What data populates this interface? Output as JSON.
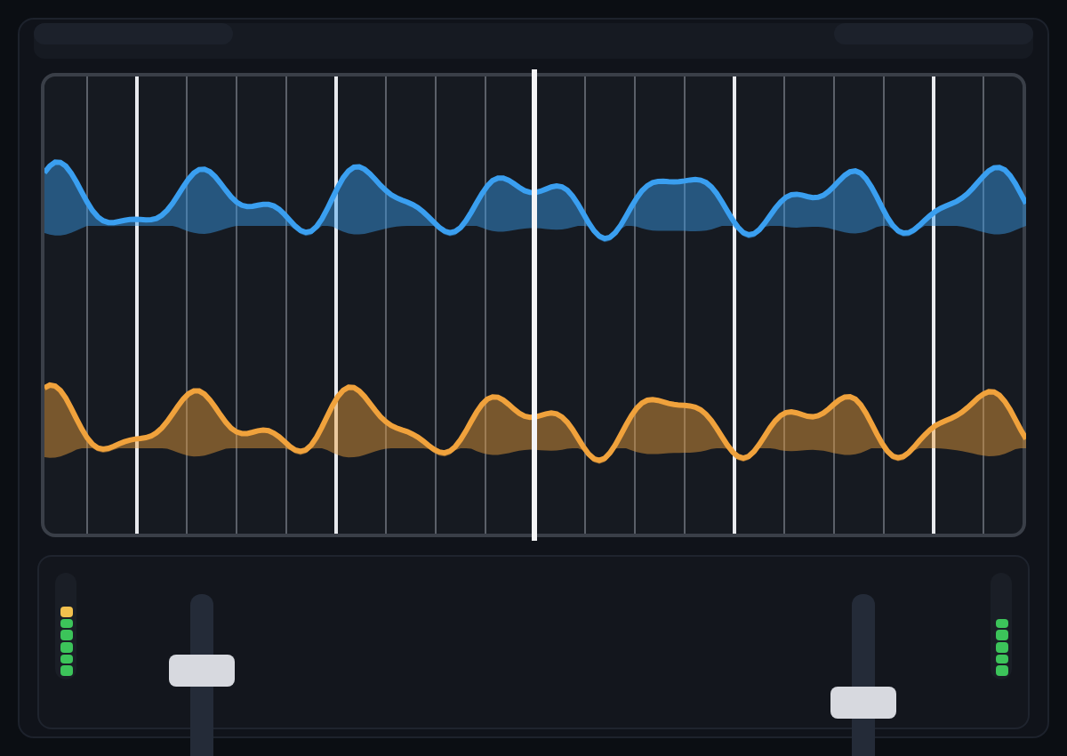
{
  "tracks": [
    {
      "color": "#3a9ff0"
    },
    {
      "color": "#f0a23c"
    }
  ],
  "decks": [
    {
      "meter": {
        "segments": [
          {
            "color": "#f2c14e"
          },
          {
            "color": "#3cc45a"
          },
          {
            "color": "#3cc45a"
          },
          {
            "color": "#3cc45a"
          },
          {
            "color": "#3cc45a"
          },
          {
            "color": "#3cc45a"
          }
        ]
      },
      "fader": {
        "level": 0.56
      }
    },
    {
      "meter": {
        "segments": [
          {
            "color": "#3cc45a"
          },
          {
            "color": "#3cc45a"
          },
          {
            "color": "#3cc45a"
          },
          {
            "color": "#3cc45a"
          },
          {
            "color": "#3cc45a"
          }
        ]
      },
      "fader": {
        "level": 0.32
      }
    }
  ]
}
